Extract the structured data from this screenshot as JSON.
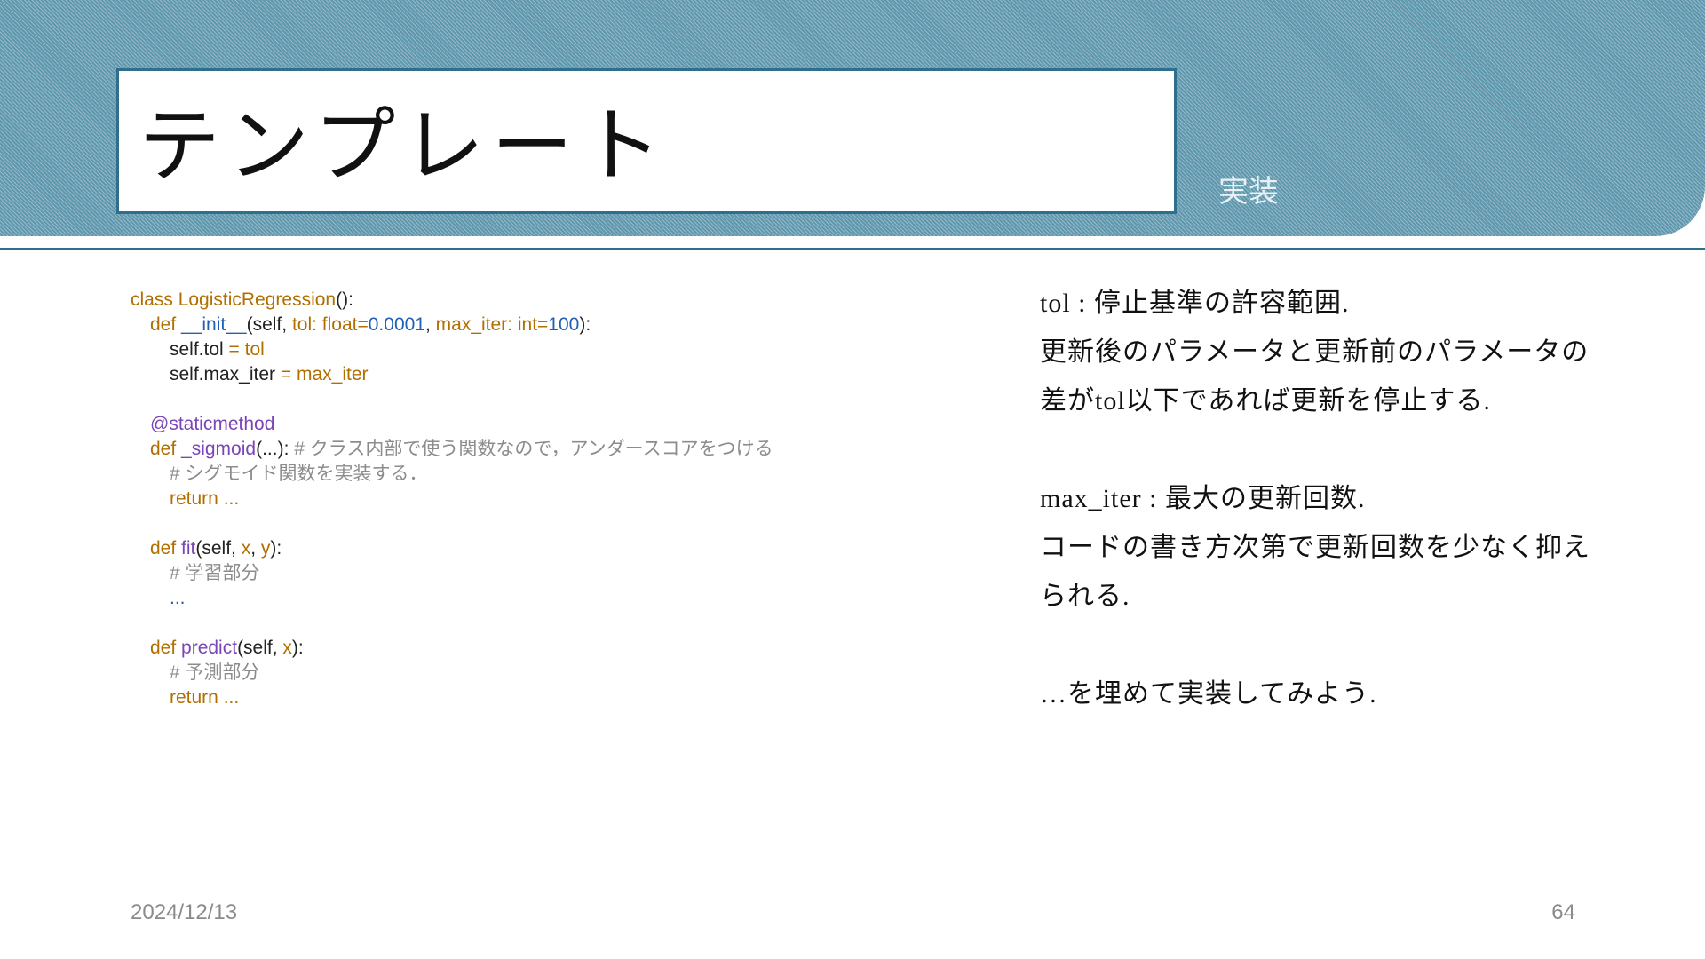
{
  "slide": {
    "title": "テンプレート",
    "subtitle": "実装",
    "date": "2024/12/13",
    "page_number": "64"
  },
  "code": {
    "l1_a": "class ",
    "l1_b": "LogisticRegression",
    "l1_c": "():",
    "l2_a": "def ",
    "l2_b": "__init__",
    "l2_c": "(self, ",
    "l2_d": "tol: float=",
    "l2_e": "0.0001",
    "l2_f": ", ",
    "l2_g": "max_iter: int=",
    "l2_h": "100",
    "l2_i": "):",
    "l3_a": "self.tol ",
    "l3_b": "= tol",
    "l4_a": "self.max_iter ",
    "l4_b": "= max_iter",
    "l5": "@staticmethod",
    "l6_a": "def ",
    "l6_b": "_sigmoid",
    "l6_c": "(...): ",
    "l6_d": "# クラス内部で使う関数なので，アンダースコアをつける",
    "l7": "# シグモイド関数を実装する．",
    "l8": "return ...",
    "l9_a": "def ",
    "l9_b": "fit",
    "l9_c": "(self, ",
    "l9_d": "x",
    "l9_e": ", ",
    "l9_f": "y",
    "l9_g": "):",
    "l10": "# 学習部分",
    "l11": "...",
    "l12_a": "def ",
    "l12_b": "predict",
    "l12_c": "(self, ",
    "l12_d": "x",
    "l12_e": "):",
    "l13": "# 予測部分",
    "l14": "return ..."
  },
  "notes": {
    "line1": "tol : 停止基準の許容範囲.",
    "line2": "更新後のパラメータと更新前のパラメータの",
    "line3": "差がtol以下であれば更新を停止する.",
    "line4": "max_iter : 最大の更新回数.",
    "line5": "コードの書き方次第で更新回数を少なく抑え",
    "line6": "られる.",
    "line7": "…を埋めて実装してみよう."
  }
}
